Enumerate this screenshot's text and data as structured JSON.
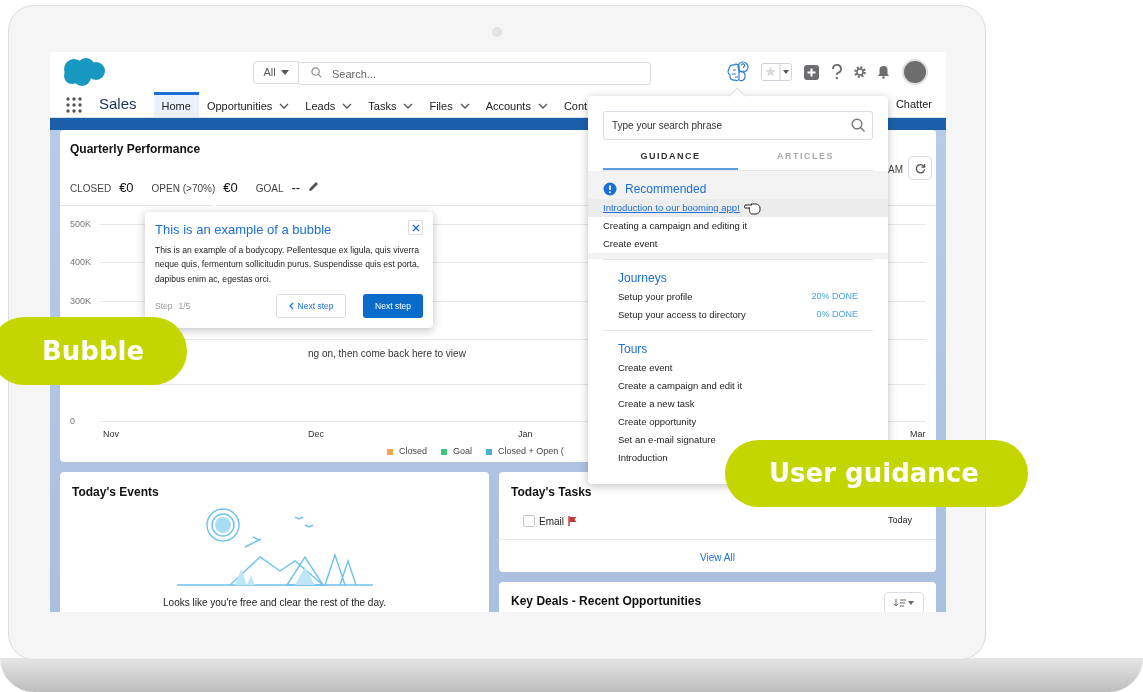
{
  "header": {
    "search_scope": "All",
    "search_placeholder": "Search..."
  },
  "app_name": "Sales",
  "nav_tabs": [
    {
      "label": "Home",
      "selected": true,
      "has_menu": false
    },
    {
      "label": "Opportunities",
      "selected": false,
      "has_menu": true
    },
    {
      "label": "Leads",
      "selected": false,
      "has_menu": true
    },
    {
      "label": "Tasks",
      "selected": false,
      "has_menu": true
    },
    {
      "label": "Files",
      "selected": false,
      "has_menu": true
    },
    {
      "label": "Accounts",
      "selected": false,
      "has_menu": true
    },
    {
      "label": "Cont",
      "selected": false,
      "has_menu": false
    }
  ],
  "nav_right": "Chatter",
  "quarterly": {
    "title": "Quarterly Performance",
    "timestamp": "AM",
    "metrics": [
      {
        "label": "CLOSED",
        "value": "€0"
      },
      {
        "label": "OPEN (>70%)",
        "value": "€0"
      },
      {
        "label": "GOAL",
        "value": "--"
      }
    ],
    "y_labels": [
      "500K",
      "400K",
      "300K",
      "0"
    ],
    "empty_message": "ng on, then come back here to view",
    "x_labels": [
      "Nov",
      "Dec",
      "Jan",
      "Mar"
    ],
    "legend": [
      {
        "label": "Closed",
        "color": "#f4a54a"
      },
      {
        "label": "Goal",
        "color": "#3fc37a"
      },
      {
        "label": "Closed + Open (",
        "color": "#4bb0d8"
      }
    ]
  },
  "bubble": {
    "title": "This is an example of a bubble",
    "body": "This is an example of a bodycopy. Pellentesque ex ligula, quis viverra neque quis, fermentum sollicitudin purus. Suspendisse quis est porta, dapibus enim ac, egestas orci.",
    "step_label": "Step",
    "step": "1/5",
    "back_button": "Next step",
    "next_button": "Next step"
  },
  "guidance": {
    "search_placeholder": "Type your search phrase",
    "tabs": [
      {
        "label": "GUIDANCE",
        "selected": true
      },
      {
        "label": "ARTICLES",
        "selected": false
      }
    ],
    "sections": [
      {
        "kind": "recommended",
        "title": "Recommended",
        "items": [
          {
            "label": "Introduction to our booming app!",
            "hovered": true
          },
          {
            "label": "Creating a campaign and editing it",
            "hovered": false
          },
          {
            "label": "Create event",
            "hovered": false
          }
        ]
      },
      {
        "kind": "journeys",
        "title": "Journeys",
        "items": [
          {
            "label": "Setup your profile",
            "progress": "20% DONE"
          },
          {
            "label": "Setup your access to directory",
            "progress": "0% DONE"
          }
        ]
      },
      {
        "kind": "tours",
        "title": "Tours",
        "items": [
          {
            "label": "Create event"
          },
          {
            "label": "Create a campaign and edit it"
          },
          {
            "label": "Create a new task"
          },
          {
            "label": "Create opportunity"
          },
          {
            "label": "Set an e-mail signature"
          },
          {
            "label": "Introduction"
          }
        ]
      }
    ]
  },
  "events": {
    "title": "Today's Events",
    "message": "Looks like you're free and clear the rest of the day."
  },
  "tasks": {
    "title": "Today's Tasks",
    "items": [
      {
        "label": "Email",
        "checked": false,
        "flagged": true,
        "due": "Today"
      }
    ],
    "view_all": "View All"
  },
  "key_deals": {
    "title": "Key Deals - Recent Opportunities"
  },
  "callouts": [
    {
      "label": "Bubble"
    },
    {
      "label": "User guidance"
    }
  ]
}
